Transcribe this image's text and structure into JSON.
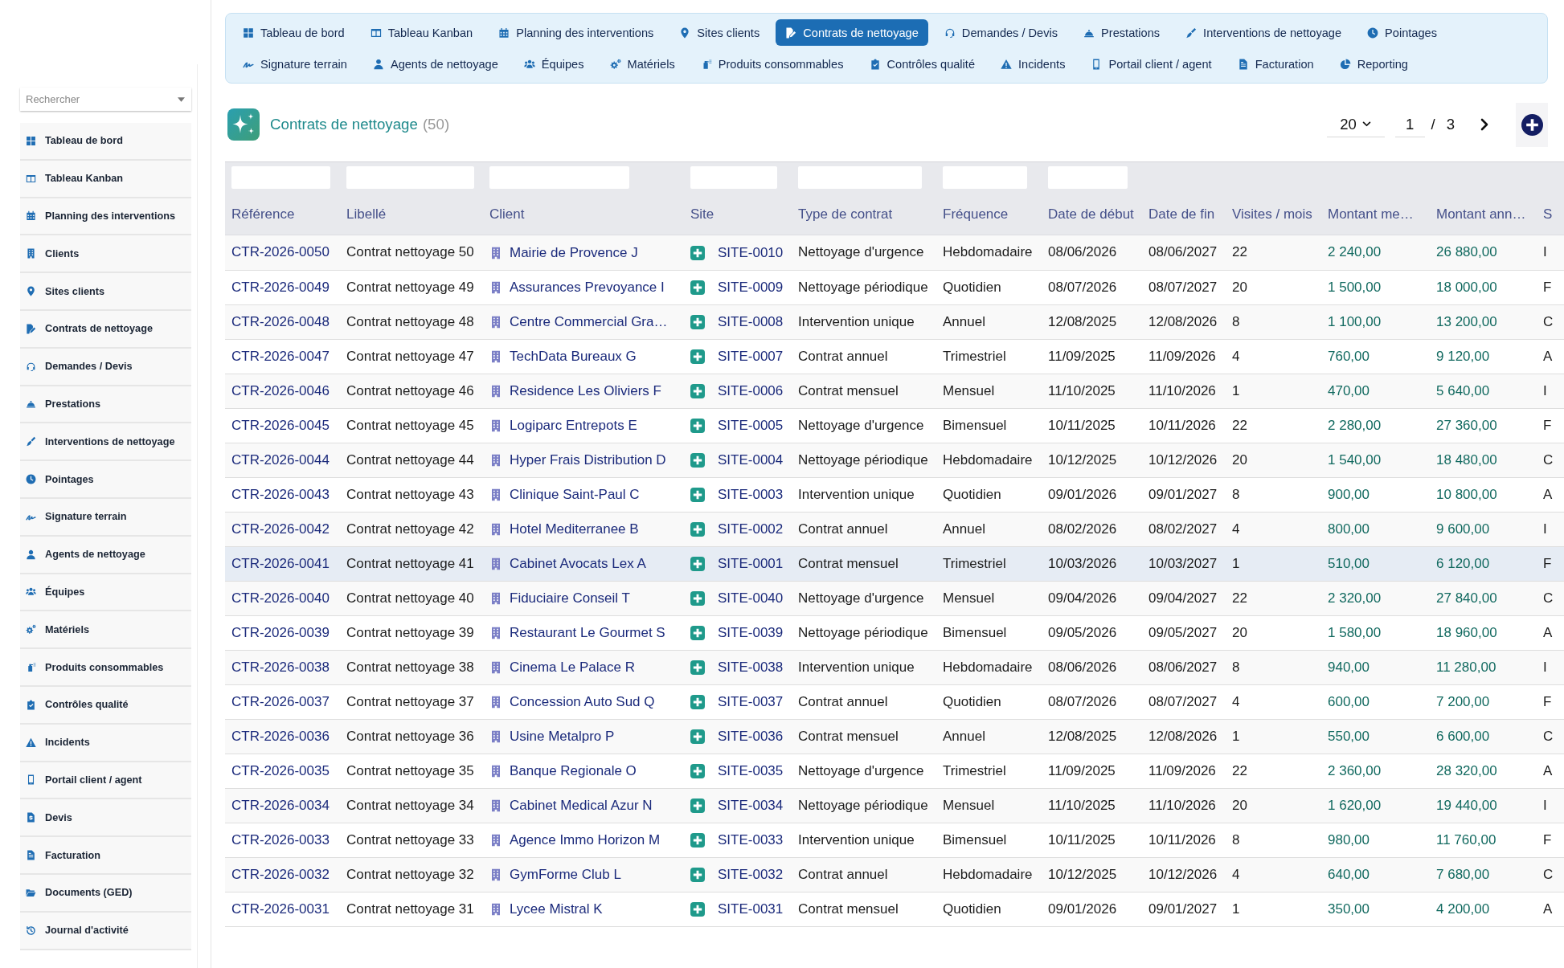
{
  "sidebar": {
    "search": {
      "placeholder": "Rechercher"
    },
    "items": [
      {
        "label": "Tableau de bord"
      },
      {
        "label": "Tableau Kanban"
      },
      {
        "label": "Planning des interventions"
      },
      {
        "label": "Clients"
      },
      {
        "label": "Sites clients"
      },
      {
        "label": "Contrats de nettoyage"
      },
      {
        "label": "Demandes / Devis"
      },
      {
        "label": "Prestations"
      },
      {
        "label": "Interventions de nettoyage"
      },
      {
        "label": "Pointages"
      },
      {
        "label": "Signature terrain"
      },
      {
        "label": "Agents de nettoyage"
      },
      {
        "label": "Équipes"
      },
      {
        "label": "Matériels"
      },
      {
        "label": "Produits consommables"
      },
      {
        "label": "Contrôles qualité"
      },
      {
        "label": "Incidents"
      },
      {
        "label": "Portail client / agent"
      },
      {
        "label": "Devis"
      },
      {
        "label": "Facturation"
      },
      {
        "label": "Documents (GED)"
      },
      {
        "label": "Journal d'activité"
      }
    ]
  },
  "nav": {
    "rows": [
      {
        "tabs": [
          {
            "label": "Tableau de bord",
            "selected": false
          },
          {
            "label": "Tableau Kanban",
            "selected": false
          },
          {
            "label": "Planning des interventions",
            "selected": false
          },
          {
            "label": "Sites clients",
            "selected": false
          },
          {
            "label": "Contrats de nettoyage",
            "selected": true
          },
          {
            "label": "Demandes / Devis",
            "selected": false
          },
          {
            "label": "Prestations",
            "selected": false
          },
          {
            "label": "Interventions de nettoyage",
            "selected": false
          },
          {
            "label": "Pointages",
            "selected": false
          }
        ]
      },
      {
        "tabs": [
          {
            "label": "Signature terrain",
            "selected": false
          },
          {
            "label": "Agents de nettoyage",
            "selected": false
          },
          {
            "label": "Équipes",
            "selected": false
          },
          {
            "label": "Matériels",
            "selected": false
          },
          {
            "label": "Produits consommables",
            "selected": false
          },
          {
            "label": "Contrôles qualité",
            "selected": false
          },
          {
            "label": "Incidents",
            "selected": false
          },
          {
            "label": "Portail client / agent",
            "selected": false
          },
          {
            "label": "Facturation",
            "selected": false
          },
          {
            "label": "Reporting",
            "selected": false
          }
        ]
      }
    ]
  },
  "header": {
    "title": "Contrats de nettoyage",
    "count": "(50)"
  },
  "pager": {
    "page_size": "20",
    "page": "1",
    "separator": "/",
    "page_count": "3"
  },
  "table": {
    "columns": [
      {
        "label": "Référence",
        "kind": "link",
        "filter": true
      },
      {
        "label": "Libellé",
        "kind": "text",
        "filter": true
      },
      {
        "label": "Client",
        "kind": "client",
        "filter": true
      },
      {
        "label": "Site",
        "kind": "site",
        "filter": true
      },
      {
        "label": "Type de contrat",
        "kind": "text",
        "filter": true
      },
      {
        "label": "Fréquence",
        "kind": "text",
        "filter": true
      },
      {
        "label": "Date de début",
        "kind": "text",
        "filter": true
      },
      {
        "label": "Date de fin",
        "kind": "text",
        "filter": false
      },
      {
        "label": "Visites / mois",
        "kind": "text",
        "filter": false
      },
      {
        "label": "Montant me…",
        "kind": "amount",
        "filter": false
      },
      {
        "label": "Montant ann…",
        "kind": "amount",
        "filter": false
      },
      {
        "label": "S",
        "kind": "text",
        "filter": false
      }
    ],
    "rows": [
      {
        "selected": false,
        "cells": [
          "CTR-2026-0050",
          "Contrat nettoyage 50",
          "Mairie de Provence J",
          "SITE-0010",
          "Nettoyage d'urgence",
          "Hebdomadaire",
          "08/06/2026",
          "08/06/2027",
          "22",
          "2 240,00",
          "26 880,00",
          "I"
        ]
      },
      {
        "selected": false,
        "cells": [
          "CTR-2026-0049",
          "Contrat nettoyage 49",
          "Assurances Prevoyance I",
          "SITE-0009",
          "Nettoyage périodique",
          "Quotidien",
          "08/07/2026",
          "08/07/2027",
          "20",
          "1 500,00",
          "18 000,00",
          "F"
        ]
      },
      {
        "selected": false,
        "cells": [
          "CTR-2026-0048",
          "Contrat nettoyage 48",
          "Centre Commercial Gra…",
          "SITE-0008",
          "Intervention unique",
          "Annuel",
          "12/08/2025",
          "12/08/2026",
          "8",
          "1 100,00",
          "13 200,00",
          "C"
        ]
      },
      {
        "selected": false,
        "cells": [
          "CTR-2026-0047",
          "Contrat nettoyage 47",
          "TechData Bureaux G",
          "SITE-0007",
          "Contrat annuel",
          "Trimestriel",
          "11/09/2025",
          "11/09/2026",
          "4",
          "760,00",
          "9 120,00",
          "A"
        ]
      },
      {
        "selected": false,
        "cells": [
          "CTR-2026-0046",
          "Contrat nettoyage 46",
          "Residence Les Oliviers F",
          "SITE-0006",
          "Contrat mensuel",
          "Mensuel",
          "11/10/2025",
          "11/10/2026",
          "1",
          "470,00",
          "5 640,00",
          "I"
        ]
      },
      {
        "selected": false,
        "cells": [
          "CTR-2026-0045",
          "Contrat nettoyage 45",
          "Logiparc Entrepots E",
          "SITE-0005",
          "Nettoyage d'urgence",
          "Bimensuel",
          "10/11/2025",
          "10/11/2026",
          "22",
          "2 280,00",
          "27 360,00",
          "F"
        ]
      },
      {
        "selected": false,
        "cells": [
          "CTR-2026-0044",
          "Contrat nettoyage 44",
          "Hyper Frais Distribution D",
          "SITE-0004",
          "Nettoyage périodique",
          "Hebdomadaire",
          "10/12/2025",
          "10/12/2026",
          "20",
          "1 540,00",
          "18 480,00",
          "C"
        ]
      },
      {
        "selected": false,
        "cells": [
          "CTR-2026-0043",
          "Contrat nettoyage 43",
          "Clinique Saint-Paul C",
          "SITE-0003",
          "Intervention unique",
          "Quotidien",
          "09/01/2026",
          "09/01/2027",
          "8",
          "900,00",
          "10 800,00",
          "A"
        ]
      },
      {
        "selected": false,
        "cells": [
          "CTR-2026-0042",
          "Contrat nettoyage 42",
          "Hotel Mediterranee B",
          "SITE-0002",
          "Contrat annuel",
          "Annuel",
          "08/02/2026",
          "08/02/2027",
          "4",
          "800,00",
          "9 600,00",
          "I"
        ]
      },
      {
        "selected": true,
        "cells": [
          "CTR-2026-0041",
          "Contrat nettoyage 41",
          "Cabinet Avocats Lex A",
          "SITE-0001",
          "Contrat mensuel",
          "Trimestriel",
          "10/03/2026",
          "10/03/2027",
          "1",
          "510,00",
          "6 120,00",
          "F"
        ]
      },
      {
        "selected": false,
        "cells": [
          "CTR-2026-0040",
          "Contrat nettoyage 40",
          "Fiduciaire Conseil T",
          "SITE-0040",
          "Nettoyage d'urgence",
          "Mensuel",
          "09/04/2026",
          "09/04/2027",
          "22",
          "2 320,00",
          "27 840,00",
          "C"
        ]
      },
      {
        "selected": false,
        "cells": [
          "CTR-2026-0039",
          "Contrat nettoyage 39",
          "Restaurant Le Gourmet S",
          "SITE-0039",
          "Nettoyage périodique",
          "Bimensuel",
          "09/05/2026",
          "09/05/2027",
          "20",
          "1 580,00",
          "18 960,00",
          "A"
        ]
      },
      {
        "selected": false,
        "cells": [
          "CTR-2026-0038",
          "Contrat nettoyage 38",
          "Cinema Le Palace R",
          "SITE-0038",
          "Intervention unique",
          "Hebdomadaire",
          "08/06/2026",
          "08/06/2027",
          "8",
          "940,00",
          "11 280,00",
          "I"
        ]
      },
      {
        "selected": false,
        "cells": [
          "CTR-2026-0037",
          "Contrat nettoyage 37",
          "Concession Auto Sud Q",
          "SITE-0037",
          "Contrat annuel",
          "Quotidien",
          "08/07/2026",
          "08/07/2027",
          "4",
          "600,00",
          "7 200,00",
          "F"
        ]
      },
      {
        "selected": false,
        "cells": [
          "CTR-2026-0036",
          "Contrat nettoyage 36",
          "Usine Metalpro P",
          "SITE-0036",
          "Contrat mensuel",
          "Annuel",
          "12/08/2025",
          "12/08/2026",
          "1",
          "550,00",
          "6 600,00",
          "C"
        ]
      },
      {
        "selected": false,
        "cells": [
          "CTR-2026-0035",
          "Contrat nettoyage 35",
          "Banque Regionale O",
          "SITE-0035",
          "Nettoyage d'urgence",
          "Trimestriel",
          "11/09/2025",
          "11/09/2026",
          "22",
          "2 360,00",
          "28 320,00",
          "A"
        ]
      },
      {
        "selected": false,
        "cells": [
          "CTR-2026-0034",
          "Contrat nettoyage 34",
          "Cabinet Medical Azur N",
          "SITE-0034",
          "Nettoyage périodique",
          "Mensuel",
          "11/10/2025",
          "11/10/2026",
          "20",
          "1 620,00",
          "19 440,00",
          "I"
        ]
      },
      {
        "selected": false,
        "cells": [
          "CTR-2026-0033",
          "Contrat nettoyage 33",
          "Agence Immo Horizon M",
          "SITE-0033",
          "Intervention unique",
          "Bimensuel",
          "10/11/2025",
          "10/11/2026",
          "8",
          "980,00",
          "11 760,00",
          "F"
        ]
      },
      {
        "selected": false,
        "cells": [
          "CTR-2026-0032",
          "Contrat nettoyage 32",
          "GymForme Club L",
          "SITE-0032",
          "Contrat annuel",
          "Hebdomadaire",
          "10/12/2025",
          "10/12/2026",
          "4",
          "640,00",
          "7 680,00",
          "C"
        ]
      },
      {
        "selected": false,
        "cells": [
          "CTR-2026-0031",
          "Contrat nettoyage 31",
          "Lycee Mistral K",
          "SITE-0031",
          "Contrat mensuel",
          "Quotidien",
          "09/01/2026",
          "09/01/2027",
          "1",
          "350,00",
          "4 200,00",
          "A"
        ]
      }
    ]
  }
}
